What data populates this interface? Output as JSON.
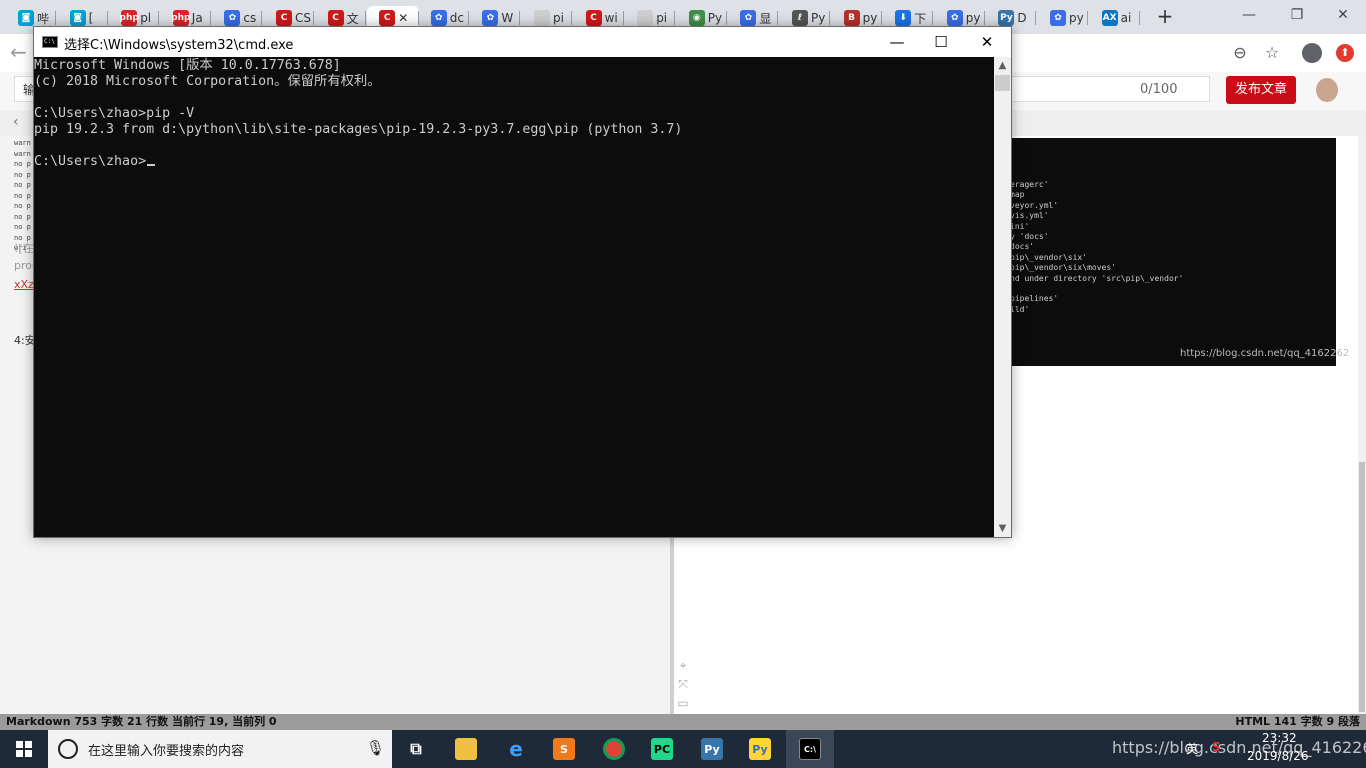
{
  "browser": {
    "tabs": [
      {
        "label": "哔",
        "color": "#00a1d6",
        "glyph": "◙"
      },
      {
        "label": "[",
        "color": "#00a1d6",
        "glyph": "◙"
      },
      {
        "label": "pl",
        "color": "#d9252a",
        "glyph": "php"
      },
      {
        "label": "Ja",
        "color": "#d9252a",
        "glyph": "php"
      },
      {
        "label": "cs",
        "color": "#3a6ee8",
        "glyph": "✿"
      },
      {
        "label": "CS",
        "color": "#d0191b",
        "glyph": "C"
      },
      {
        "label": "文",
        "color": "#d0191b",
        "glyph": "C"
      },
      {
        "label": "✕",
        "color": "#d0191b",
        "glyph": "C"
      },
      {
        "label": "dc",
        "color": "#3a6ee8",
        "glyph": "✿"
      },
      {
        "label": "W",
        "color": "#3a6ee8",
        "glyph": "✿"
      },
      {
        "label": "pi",
        "color": "#cfcfcf",
        "glyph": ""
      },
      {
        "label": "wi",
        "color": "#d0191b",
        "glyph": "C"
      },
      {
        "label": "pi",
        "color": "#cfcfcf",
        "glyph": ""
      },
      {
        "label": "Py",
        "color": "#3f8f47",
        "glyph": "◉"
      },
      {
        "label": "显",
        "color": "#3a6ee8",
        "glyph": "✿"
      },
      {
        "label": "Py",
        "color": "#555555",
        "glyph": "ℓ"
      },
      {
        "label": "py",
        "color": "#b5322a",
        "glyph": "B"
      },
      {
        "label": "下",
        "color": "#1a73e8",
        "glyph": "⬇"
      },
      {
        "label": "py",
        "color": "#3a6ee8",
        "glyph": "✿"
      },
      {
        "label": "D",
        "color": "#3776ab",
        "glyph": "Py"
      },
      {
        "label": "py",
        "color": "#3a6ee8",
        "glyph": "✿"
      },
      {
        "label": "ai",
        "color": "#0a75c2",
        "glyph": "AX"
      }
    ],
    "new_tab": "+",
    "window_controls": {
      "minimize": "—",
      "maximize": "❐",
      "close": "✕"
    }
  },
  "toolbar": {
    "back": "←",
    "zoom": "⊖",
    "star": "☆"
  },
  "page": {
    "title_prefix": "输",
    "counter": "0/100",
    "publish": "发布文章"
  },
  "editor": {
    "mini_lines": [
      "warn",
      "warn",
      "no p",
      "no p",
      "no p",
      "no p",
      "no p",
      "no p",
      "no p",
      "no p",
      "wri"
    ],
    "frag1": "![在",
    "frag2": "proc",
    "frag3": "xXz",
    "heading": "4:安"
  },
  "preview": {
    "lines": [
      "eragerc'",
      "map",
      "veyor.yml'",
      "vis.yml'",
      "ini'",
      "y 'docs'",
      "docs'",
      "pip\\_vendor\\six'",
      "pip\\_vendor\\six\\moves'",
      "nd under directory 'src\\pip\\_vendor'",
      "",
      "pipelines'",
      "ild'"
    ],
    "image_watermark": "https://blog.csdn.net/qq_4162262"
  },
  "statusbar": {
    "left": "Markdown  753 字数  21 行数  当前行 19, 当前列 0",
    "right": "HTML  141 字数  9 段落"
  },
  "taskbar": {
    "search_placeholder": "在这里输入你要搜索的内容",
    "tray_lang": "英",
    "time": "23:32",
    "date": "2019/8/26",
    "url_watermark": "https://blog.csdn.net/qq_41622627"
  },
  "cmd": {
    "title": "选择C:\\Windows\\system32\\cmd.exe",
    "lines": [
      "Microsoft Windows [版本 10.0.17763.678]",
      "(c) 2018 Microsoft Corporation。保留所有权利。",
      "",
      "C:\\Users\\zhao>pip -V",
      "pip 19.2.3 from d:\\python\\lib\\site-packages\\pip-19.2.3-py3.7.egg\\pip (python 3.7)",
      "",
      "C:\\Users\\zhao>"
    ],
    "controls": {
      "minimize": "—",
      "maximize": "☐",
      "close": "✕"
    }
  }
}
